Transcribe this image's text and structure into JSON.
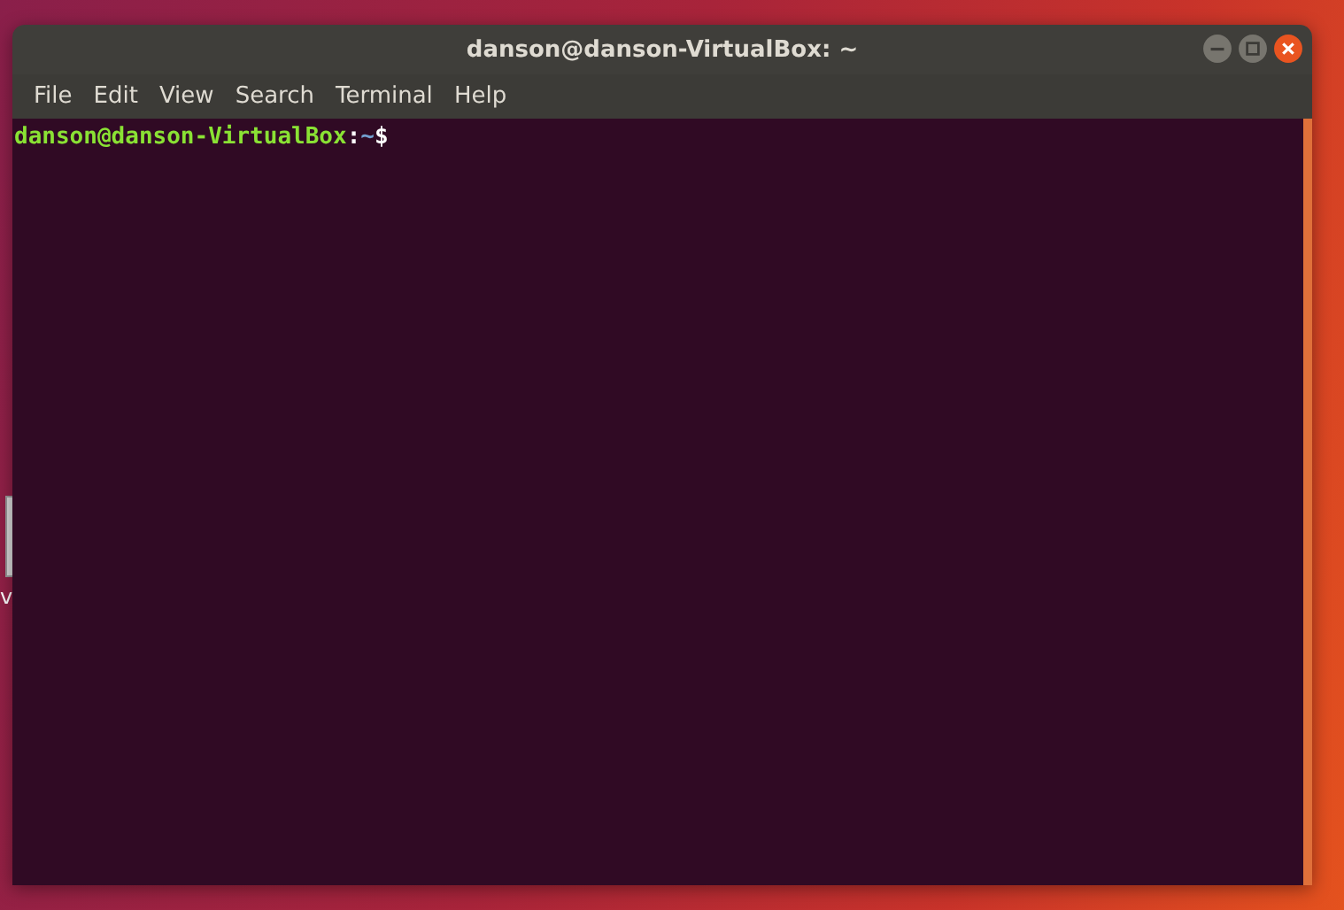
{
  "desktop": {
    "icon_label": "v"
  },
  "window": {
    "title": "danson@danson-VirtualBox: ~"
  },
  "menu": [
    {
      "label": "File"
    },
    {
      "label": "Edit"
    },
    {
      "label": "View"
    },
    {
      "label": "Search"
    },
    {
      "label": "Terminal"
    },
    {
      "label": "Help"
    }
  ],
  "terminal": {
    "prompt": {
      "user_host": "danson@danson-VirtualBox",
      "separator": ":",
      "path": "~",
      "symbol": "$"
    }
  }
}
